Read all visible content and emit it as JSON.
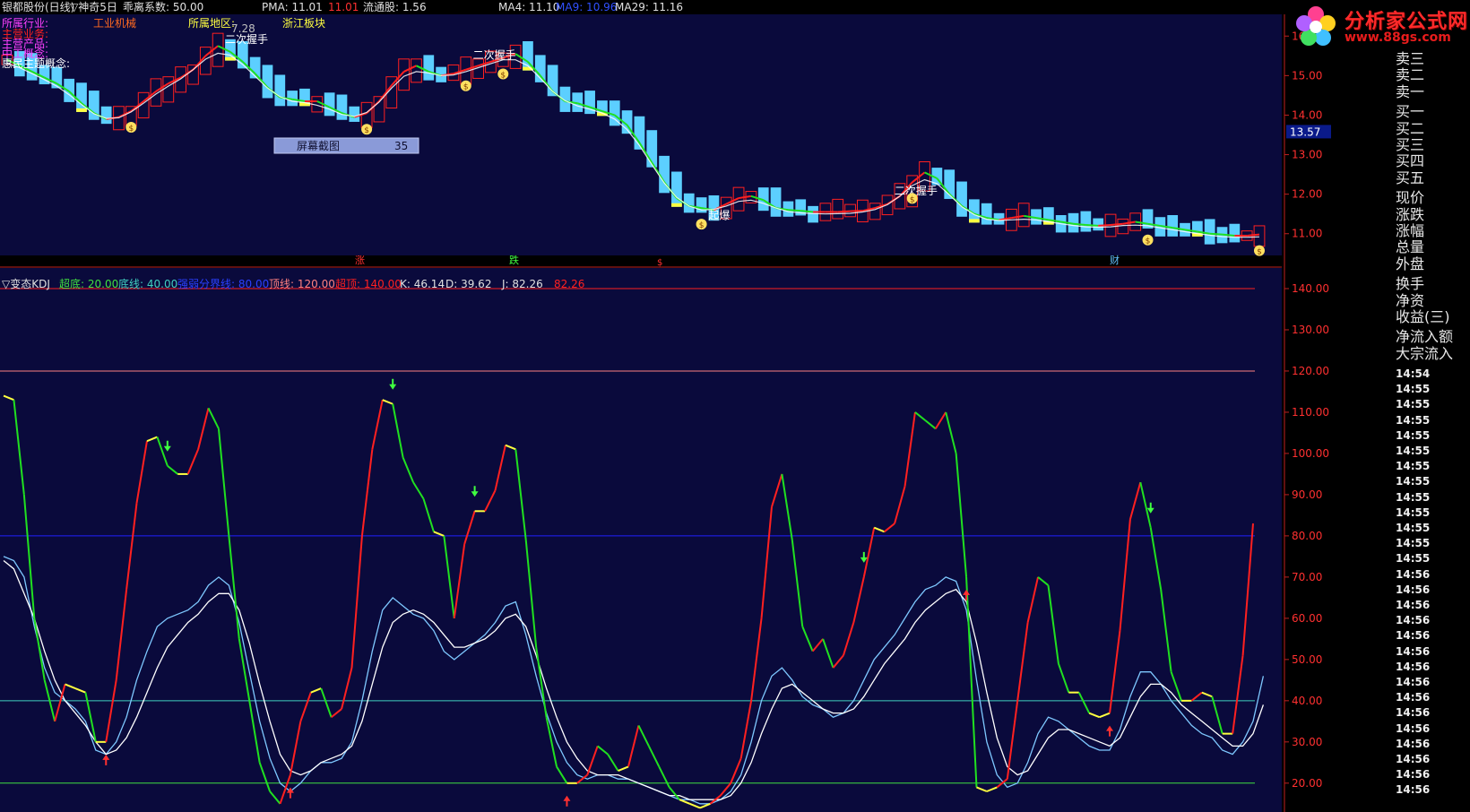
{
  "header": {
    "stock": "银都股份(日线)",
    "indicator": "▽神奇5日",
    "coef_label": "乖离系数: 50.00",
    "pma_label": "PMA: 11.01",
    "pma_value": "11.01",
    "float_label": "流通股: 1.56",
    "ma4": "MA4: 11.10",
    "ma9": "MA9: 10.96",
    "ma29": "MA29: 11.16"
  },
  "info": {
    "industry_label": "所属行业:",
    "industry_value": "工业机械",
    "region_label": "所属地区:",
    "region_value": "浙江板块",
    "region_num": "7.28",
    "main_business": "主营业务:",
    "main_product": "主营产品:",
    "secondary": "中工概念:",
    "concept": "惠民主题概念:"
  },
  "logo": {
    "text": "分析家公式网",
    "url": "www.88gs.com"
  },
  "tooltip": {
    "label": "屏幕截图",
    "value": "35"
  },
  "markers": {
    "zhang": "涨",
    "die": "跌",
    "dollar": "$",
    "cai": "财"
  },
  "kdj_header": {
    "name": "▽变态KDJ",
    "chaodi": "超底: 20.00",
    "dixian": "底线: 40.00",
    "qiangruo": "强弱分界线: 80.00",
    "dingxian": "顶线: 120.00",
    "chaoding": "超顶: 140.00",
    "k": "K: 46.14",
    "d": "D: 39.62",
    "j": "J: 82.26",
    "j2": "82.26"
  },
  "side_panel": {
    "labels": [
      "卖三",
      "卖二",
      "卖一",
      "买一",
      "买二",
      "买三",
      "买四",
      "买五",
      "现价",
      "涨跌",
      "涨幅",
      "总量",
      "外盘",
      "换手",
      "净资",
      "收益(三)",
      "净流入额",
      "大宗流入"
    ],
    "times": [
      "14:54",
      "14:55",
      "14:55",
      "14:55",
      "14:55",
      "14:55",
      "14:55",
      "14:55",
      "14:55",
      "14:55",
      "14:55",
      "14:55",
      "14:55",
      "14:56",
      "14:56",
      "14:56",
      "14:56",
      "14:56",
      "14:56",
      "14:56",
      "14:56",
      "14:56",
      "14:56",
      "14:56",
      "14:56",
      "14:56",
      "14:56",
      "14:56"
    ]
  },
  "colors": {
    "bg": "#0a0a3c",
    "up": "#ff2020",
    "down": "#5ccfff",
    "green": "#20e020",
    "yellow": "#ffff40",
    "white": "#ffffff",
    "lightblue": "#7ec8ff"
  },
  "chart_data": [
    {
      "type": "candlestick",
      "title": "",
      "yticks": [
        11.0,
        12.0,
        13.0,
        14.0,
        15.0,
        16.0
      ],
      "ylim": [
        10.45,
        16.55
      ],
      "current_price": "13.57",
      "annotations": [
        "二次握手",
        "二次握手",
        "二次握手",
        "起爆"
      ],
      "ma_line": [
        15.4,
        15.25,
        15.1,
        14.95,
        14.8,
        14.6,
        14.3,
        14.05,
        13.9,
        13.95,
        14.1,
        14.35,
        14.6,
        14.8,
        14.95,
        15.15,
        15.5,
        15.75,
        15.6,
        15.35,
        15.05,
        14.7,
        14.45,
        14.4,
        14.35,
        14.35,
        14.2,
        14.05,
        13.95,
        14.05,
        14.35,
        14.75,
        15.1,
        15.25,
        15.1,
        15.0,
        15.05,
        15.15,
        15.25,
        15.35,
        15.45,
        15.55,
        15.35,
        15.0,
        14.6,
        14.35,
        14.3,
        14.2,
        14.1,
        14.0,
        13.75,
        13.3,
        12.8,
        12.3,
        11.9,
        11.7,
        11.65,
        11.6,
        11.75,
        11.9,
        11.95,
        11.85,
        11.65,
        11.6,
        11.58,
        11.55,
        11.55,
        11.55,
        11.57,
        11.58,
        11.65,
        11.75,
        11.95,
        12.3,
        12.55,
        12.4,
        12.0,
        11.7,
        11.5,
        11.4,
        11.35,
        11.4,
        11.45,
        11.4,
        11.35,
        11.3,
        11.25,
        11.22,
        11.2,
        11.22,
        11.25,
        11.3,
        11.25,
        11.2,
        11.15,
        11.1,
        11.05,
        11.0,
        10.98,
        10.95,
        10.95,
        10.98
      ]
    },
    {
      "type": "line",
      "title": "",
      "yticks": [
        20,
        30,
        40,
        50,
        60,
        70,
        80,
        90,
        100,
        110,
        120,
        130,
        140
      ],
      "ylim": [
        13,
        145
      ],
      "hlines": [
        {
          "value": 140,
          "color": "#ff2020"
        },
        {
          "value": 120,
          "color": "#ff8080"
        },
        {
          "value": 80,
          "color": "#2020ff"
        },
        {
          "value": 40,
          "color": "#40d0c0"
        },
        {
          "value": 20,
          "color": "#40e040"
        }
      ],
      "series": [
        {
          "values": [
            114,
            113,
            90,
            60,
            45,
            35,
            44,
            43,
            42,
            30,
            30,
            45,
            67,
            88,
            103,
            104,
            97,
            95,
            95,
            101,
            111,
            106,
            80,
            55,
            40,
            25,
            18,
            15,
            22,
            35,
            42,
            43,
            36,
            38,
            48,
            80,
            101,
            113,
            112,
            99,
            93,
            89,
            81,
            80,
            60,
            78,
            86,
            86,
            91,
            102,
            101,
            79,
            53,
            36,
            24,
            20,
            20,
            22,
            29,
            27,
            23,
            24,
            34,
            29,
            24,
            19,
            16,
            15,
            14,
            15,
            17,
            20,
            26,
            40,
            60,
            87,
            95,
            79,
            58,
            52,
            55,
            48,
            51,
            59,
            70,
            82,
            81,
            83,
            92,
            110,
            108,
            106,
            110,
            100,
            70,
            19,
            18,
            19,
            21,
            40,
            59,
            70,
            68,
            49,
            42,
            42,
            37,
            36,
            37,
            57,
            84,
            93,
            82,
            67,
            47,
            40,
            40,
            42,
            41,
            32,
            32,
            51,
            83
          ]
        },
        {
          "values": [
            75,
            74,
            70,
            58,
            48,
            42,
            40,
            38,
            35,
            28,
            27,
            30,
            36,
            45,
            52,
            58,
            60,
            61,
            62,
            64,
            68,
            70,
            68,
            59,
            47,
            35,
            26,
            20,
            18,
            20,
            23,
            25,
            25,
            26,
            30,
            40,
            52,
            62,
            65,
            63,
            61,
            60,
            57,
            52,
            50,
            52,
            54,
            56,
            59,
            63,
            64,
            56,
            46,
            37,
            30,
            25,
            22,
            21,
            22,
            22,
            21,
            21,
            20,
            19,
            18,
            17,
            16,
            16,
            15,
            15,
            16,
            18,
            22,
            30,
            40,
            46,
            48,
            45,
            41,
            39,
            38,
            36,
            37,
            40,
            45,
            50,
            53,
            56,
            60,
            64,
            67,
            68,
            70,
            69,
            62,
            45,
            30,
            22,
            19,
            20,
            25,
            32,
            36,
            35,
            33,
            31,
            29,
            28,
            28,
            33,
            41,
            47,
            47,
            44,
            40,
            37,
            34,
            32,
            31,
            28,
            27,
            30,
            35,
            46
          ]
        },
        {
          "values": [
            74,
            72,
            66,
            60,
            52,
            45,
            40,
            37,
            34,
            30,
            27,
            28,
            31,
            36,
            42,
            48,
            53,
            56,
            59,
            61,
            64,
            66,
            66,
            62,
            54,
            44,
            35,
            27,
            23,
            22,
            23,
            25,
            26,
            27,
            29,
            35,
            44,
            53,
            59,
            61,
            62,
            61,
            59,
            56,
            53,
            53,
            54,
            55,
            57,
            60,
            61,
            58,
            51,
            43,
            36,
            30,
            26,
            23,
            22,
            22,
            22,
            21,
            20,
            19,
            18,
            17,
            17,
            16,
            16,
            16,
            16,
            17,
            20,
            25,
            32,
            38,
            43,
            44,
            42,
            40,
            38,
            37,
            37,
            38,
            41,
            45,
            49,
            52,
            55,
            59,
            62,
            64,
            66,
            67,
            64,
            54,
            42,
            31,
            24,
            22,
            23,
            27,
            31,
            33,
            33,
            32,
            31,
            30,
            29,
            31,
            36,
            41,
            44,
            44,
            42,
            39,
            37,
            35,
            33,
            31,
            29,
            29,
            32,
            39
          ]
        }
      ]
    }
  ]
}
